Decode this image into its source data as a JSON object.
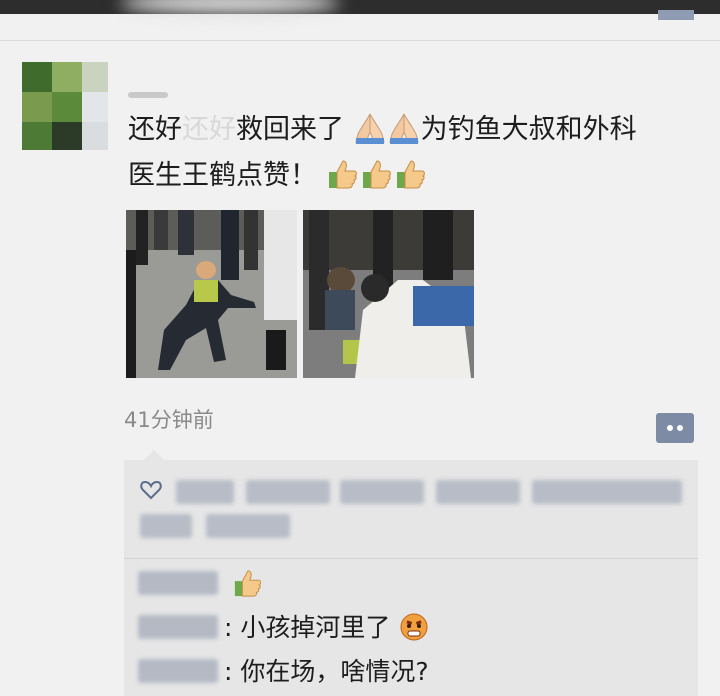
{
  "post": {
    "text_prefix": "还好",
    "text_ghost": "还好",
    "text_main": "救回来了",
    "text_line_rest": "为钓鱼大叔和外科",
    "text_line2": "医生王鹤点赞！",
    "time": "41分钟前"
  },
  "comments": [
    {
      "text": ""
    },
    {
      "text": ": 小孩掉河里了"
    },
    {
      "text": ": 你在场，啥情况?"
    }
  ],
  "icons": {
    "pray": "folded-hands-emoji",
    "thumbs": "thumbs-up-emoji",
    "heart": "heart-outline-icon",
    "comment": "comment-dots-icon",
    "angry": "angry-face-emoji"
  },
  "colors": {
    "comment_button": "#7e8ba4",
    "likes_background": "#e6e6e6",
    "page_background": "#f1f1f1"
  }
}
